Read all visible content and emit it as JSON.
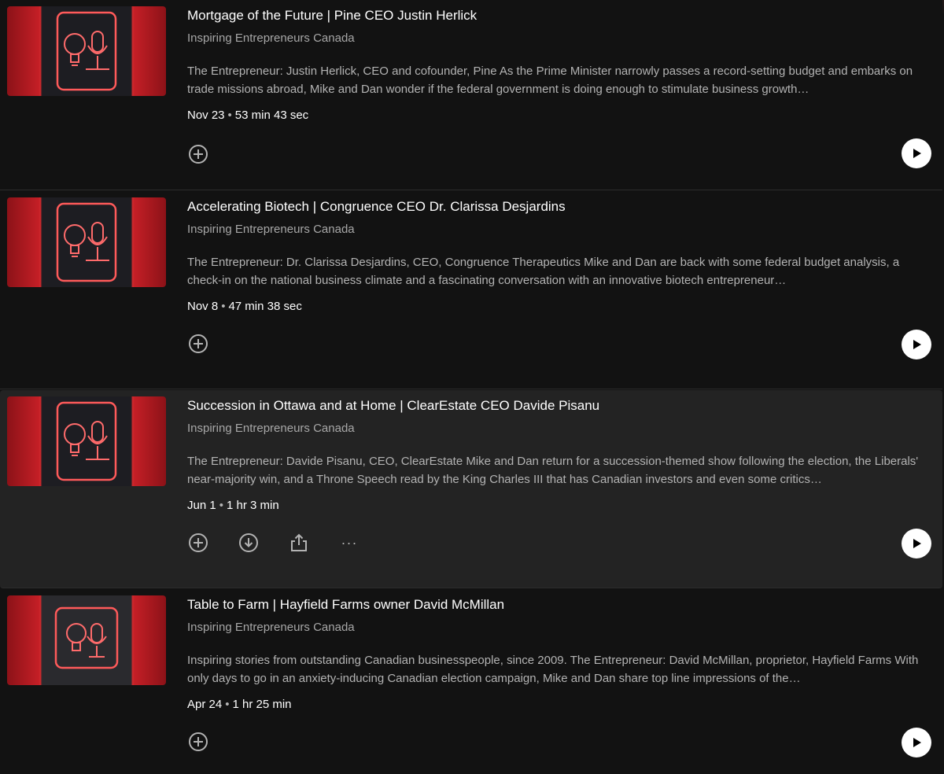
{
  "episodes": [
    {
      "title": "Mortgage of the Future | Pine CEO Justin Herlick",
      "show": "Inspiring Entrepreneurs Canada",
      "description": "The Entrepreneur: Justin Herlick, CEO and cofounder, Pine   As the Prime Minister narrowly passes a record-setting budget and embarks on trade missions abroad, Mike and Dan wonder if the federal government is doing enough to stimulate business growth…",
      "date": "Nov 23",
      "duration": "53 min 43 sec",
      "hovered": false
    },
    {
      "title": "Accelerating Biotech | Congruence CEO Dr. Clarissa Desjardins",
      "show": "Inspiring Entrepreneurs Canada",
      "description": "The Entrepreneur: Dr. Clarissa Desjardins, CEO, Congruence Therapeutics   Mike and Dan are back with some federal budget analysis, a check-in on the national business climate and a fascinating conversation with an innovative biotech entrepreneur…",
      "date": "Nov 8",
      "duration": "47 min 38 sec",
      "hovered": false
    },
    {
      "title": "Succession in Ottawa and at Home | ClearEstate CEO Davide Pisanu",
      "show": "Inspiring Entrepreneurs Canada",
      "description": "The Entrepreneur: Davide Pisanu, CEO, ClearEstate   Mike and Dan return for a succession-themed show following the election, the Liberals' near-majority win, and a Throne Speech read by the King Charles III that has Canadian investors and even some critics…",
      "date": "Jun 1",
      "duration": "1 hr 3 min",
      "hovered": true
    },
    {
      "title": "Table to Farm | Hayfield Farms owner David McMillan",
      "show": "Inspiring Entrepreneurs Canada",
      "description": "Inspiring stories from outstanding Canadian businesspeople, since 2009.  The Entrepreneur: David McMillan, proprietor, Hayfield Farms With only days to go in an anxiety-inducing Canadian election campaign, Mike and Dan share top line impressions of the…",
      "date": "Apr 24",
      "duration": "1 hr 25 min",
      "hovered": false
    }
  ],
  "separator": "•",
  "more_glyph": "···",
  "colors": {
    "background": "#121212",
    "hover_background": "#232323",
    "neon_red": "#ff5a5a",
    "brand_red": "#c41f26"
  }
}
